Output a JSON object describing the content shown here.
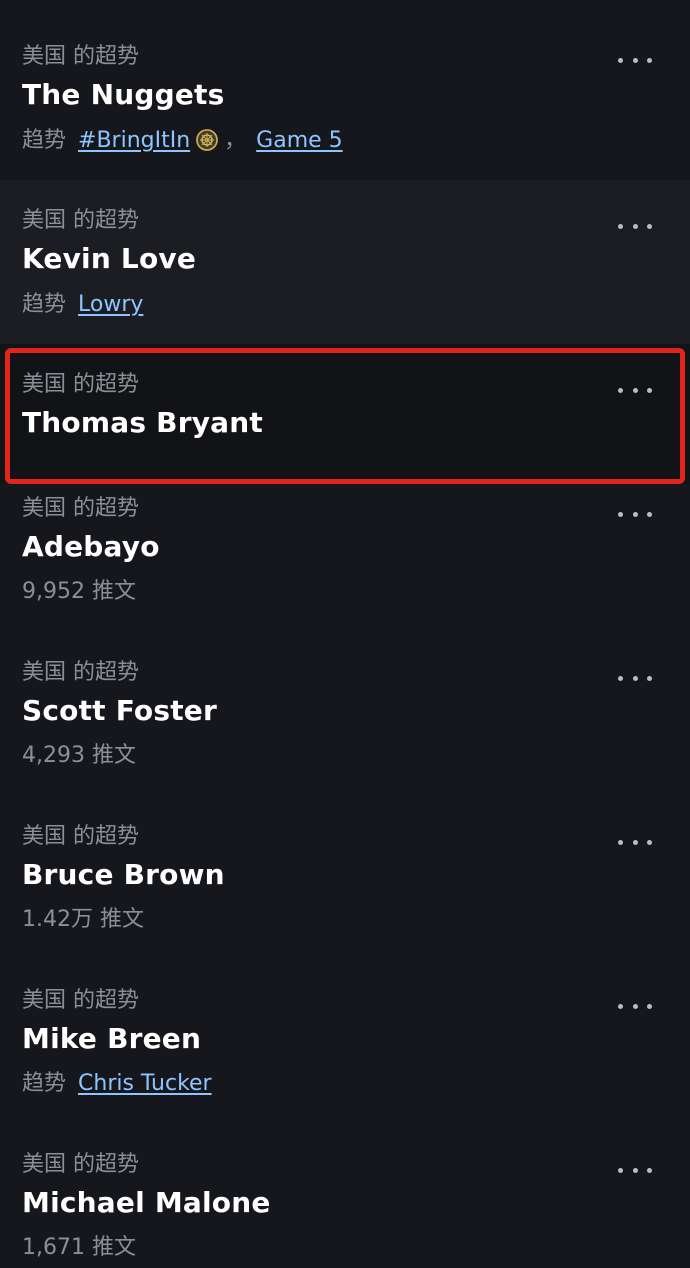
{
  "trends": [
    {
      "context": "美国 的超势",
      "title": "The Nuggets",
      "meta_prefix": "趋势",
      "links": [
        "#BringItIn",
        "Game 5"
      ],
      "emoji": "nuggets-logo-icon",
      "separator": "，"
    },
    {
      "context": "美国 的超势",
      "title": "Kevin Love",
      "meta_prefix": "趋势",
      "links": [
        "Lowry"
      ]
    },
    {
      "context": "美国 的超势",
      "title": "Thomas Bryant"
    },
    {
      "context": "美国 的超势",
      "title": "Adebayo",
      "count": "9,952 推文"
    },
    {
      "context": "美国 的超势",
      "title": "Scott Foster",
      "count": "4,293 推文"
    },
    {
      "context": "美国 的超势",
      "title": "Bruce Brown",
      "count": "1.42万 推文"
    },
    {
      "context": "美国 的超势",
      "title": "Mike Breen",
      "meta_prefix": "趋势",
      "links": [
        "Chris Tucker"
      ]
    },
    {
      "context": "美国 的超势",
      "title": "Michael Malone",
      "count": "1,671 推文"
    }
  ],
  "colors": {
    "background": "#16171c",
    "hover_background": "#1c1d23",
    "link": "#8ec5ff",
    "secondary_text": "#8b9097",
    "highlight_border": "#e1251b"
  },
  "more_icon": "more-horizontal-icon"
}
